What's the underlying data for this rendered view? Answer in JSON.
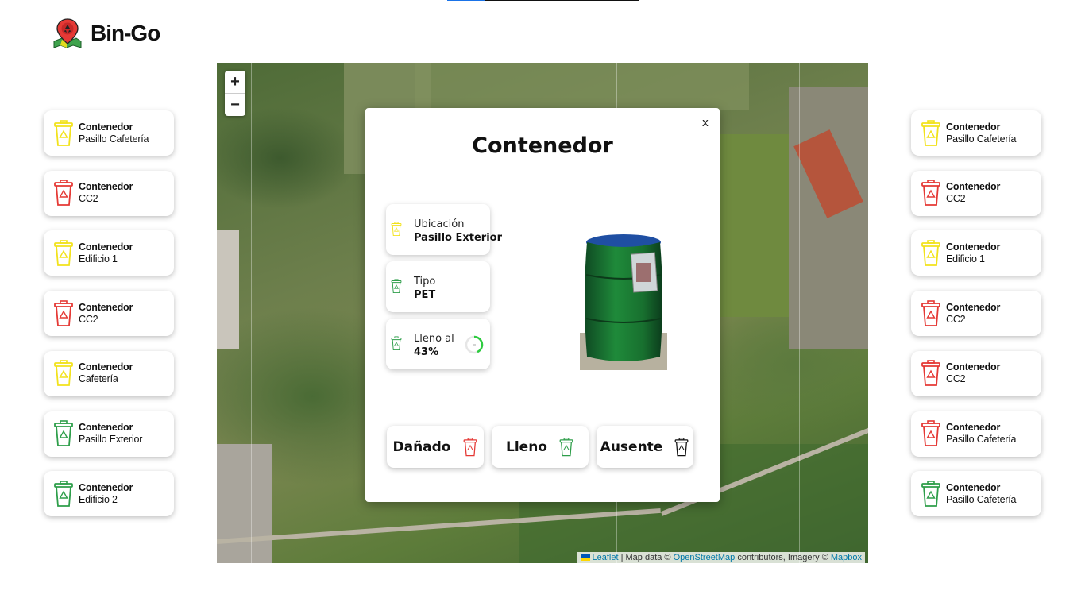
{
  "app": {
    "name": "Bin-Go"
  },
  "top_progress": {
    "fraction": 0.2
  },
  "left_bins": [
    {
      "title": "Contenedor",
      "location": "Pasillo Cafetería",
      "color": "#f2e21b"
    },
    {
      "title": "Contenedor",
      "location": "CC2",
      "color": "#e53935"
    },
    {
      "title": "Contenedor",
      "location": "Edificio 1",
      "color": "#f2e21b"
    },
    {
      "title": "Contenedor",
      "location": "CC2",
      "color": "#e53935"
    },
    {
      "title": "Contenedor",
      "location": "Cafetería",
      "color": "#f2e21b"
    },
    {
      "title": "Contenedor",
      "location": "Pasillo Exterior",
      "color": "#2e9e4a"
    },
    {
      "title": "Contenedor",
      "location": "Edificio 2",
      "color": "#2e9e4a"
    }
  ],
  "right_bins": [
    {
      "title": "Contenedor",
      "location": "Pasillo Cafetería",
      "color": "#f2e21b"
    },
    {
      "title": "Contenedor",
      "location": "CC2",
      "color": "#e53935"
    },
    {
      "title": "Contenedor",
      "location": "Edificio 1",
      "color": "#f2e21b"
    },
    {
      "title": "Contenedor",
      "location": "CC2",
      "color": "#e53935"
    },
    {
      "title": "Contenedor",
      "location": "CC2",
      "color": "#e53935"
    },
    {
      "title": "Contenedor",
      "location": "Pasillo Cafetería",
      "color": "#e53935"
    },
    {
      "title": "Contenedor",
      "location": "Pasillo Cafetería",
      "color": "#2e9e4a"
    }
  ],
  "map": {
    "zoom_in": "+",
    "zoom_out": "−",
    "attribution": {
      "leaflet": "Leaflet",
      "sep": " | Map data © ",
      "osm": "OpenStreetMap",
      "mid": " contributors, Imagery © ",
      "mapbox": "Mapbox"
    }
  },
  "modal": {
    "close": "x",
    "title": "Contenedor",
    "location_label": "Ubicación",
    "location_value": "Pasillo Exterior",
    "type_label": "Tipo",
    "type_value": "PET",
    "fill_label": "Lleno al",
    "fill_value": "43%",
    "fill_fraction": 0.43,
    "actions": [
      {
        "label": "Dañado",
        "color": "#e53935"
      },
      {
        "label": "Lleno",
        "color": "#2e9e4a"
      },
      {
        "label": "Ausente",
        "color": "#111111"
      }
    ]
  },
  "icons": {
    "bin": "recycle-bin-icon",
    "logo": "map-pin-recycle-icon"
  },
  "colors": {
    "yellow": "#f2e21b",
    "red": "#e53935",
    "green": "#2e9e4a",
    "gauge": "#2ecc40"
  }
}
